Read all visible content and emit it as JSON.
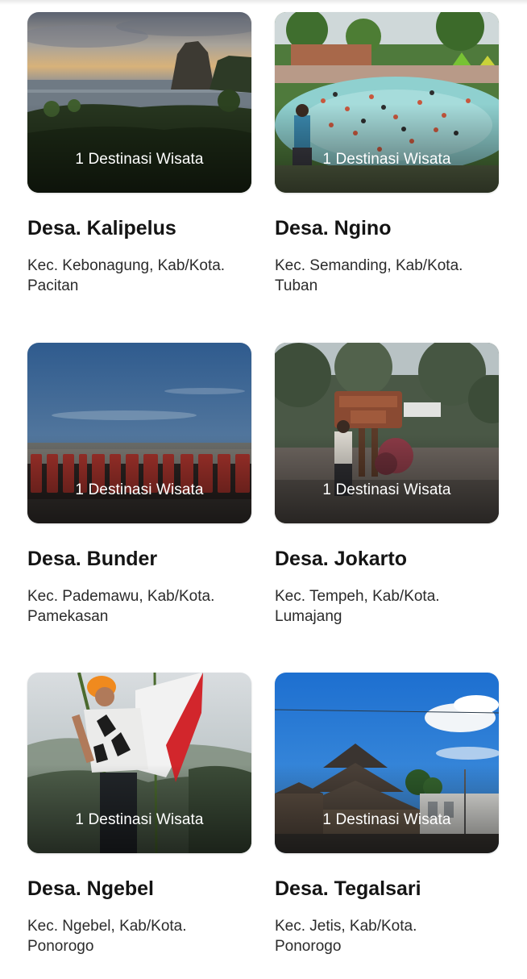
{
  "villages": [
    {
      "count_label": "1 Destinasi Wisata",
      "name": "Desa. Kalipelus",
      "location_line1": "Kec. Kebonagung, Kab/Kota.",
      "location_line2": "Pacitan",
      "image_subject": "coastal-rock-sunset"
    },
    {
      "count_label": "1 Destinasi Wisata",
      "name": "Desa. Ngino",
      "location_line1": "Kec. Semanding, Kab/Kota.",
      "location_line2": "Tuban",
      "image_subject": "crowded-swimming-pool"
    },
    {
      "count_label": "1 Destinasi Wisata",
      "name": "Desa. Bunder",
      "location_line1": "Kec. Pademawu, Kab/Kota.",
      "location_line2": "Pamekasan",
      "image_subject": "red-landmark-letters-sky"
    },
    {
      "count_label": "1 Destinasi Wisata",
      "name": "Desa. Jokarto",
      "location_line1": "Kec. Tempeh, Kab/Kota.",
      "location_line2": "Lumajang",
      "image_subject": "welcome-sign-park"
    },
    {
      "count_label": "1 Destinasi Wisata",
      "name": "Desa. Ngebel",
      "location_line1": "Kec. Ngebel, Kab/Kota.",
      "location_line2": "Ponorogo",
      "image_subject": "climber-with-flag"
    },
    {
      "count_label": "1 Destinasi Wisata",
      "name": "Desa. Tegalsari",
      "location_line1": "Kec. Jetis, Kab/Kota.",
      "location_line2": "Ponorogo",
      "image_subject": "traditional-mosque-blue-sky"
    }
  ]
}
